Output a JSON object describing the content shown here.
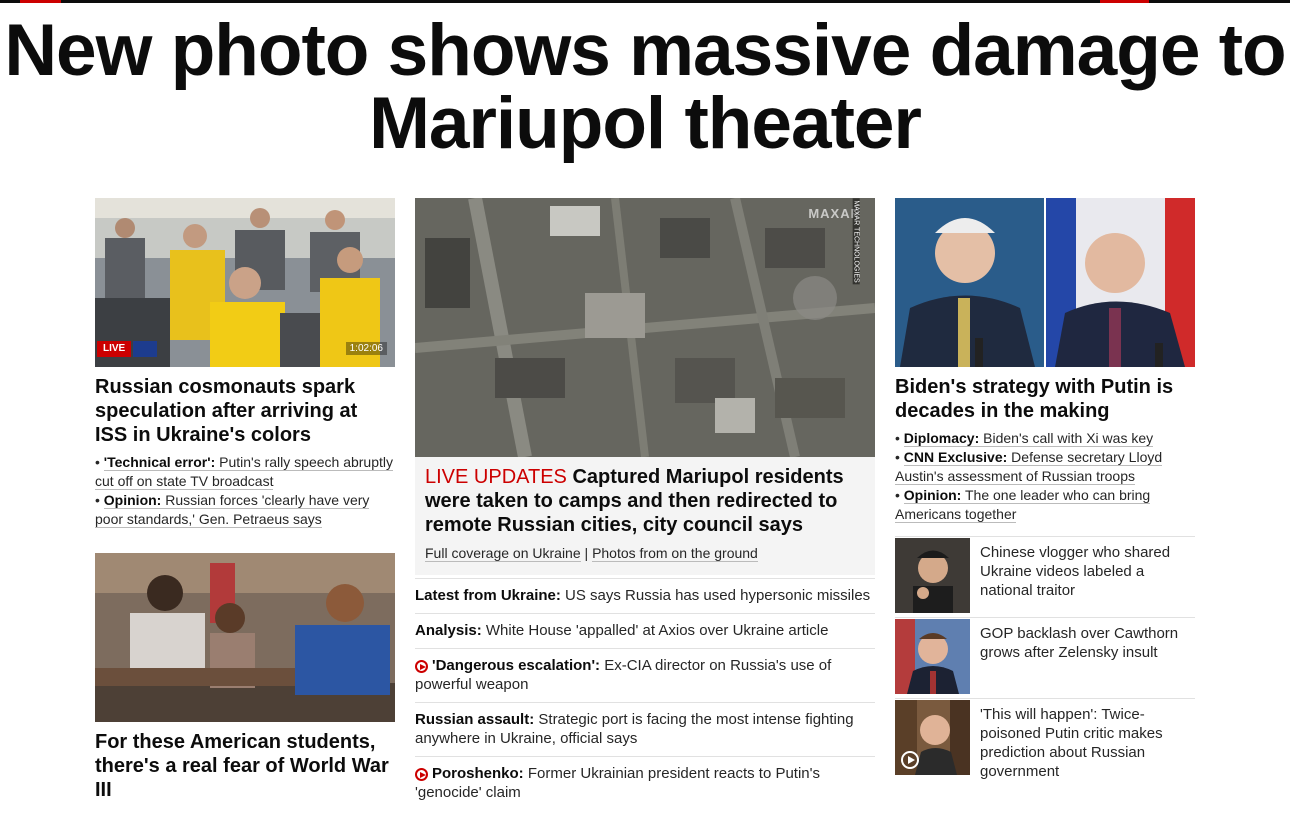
{
  "headline": "New photo shows massive damage to Mariupol theater",
  "left": {
    "story1": {
      "live_label": "LIVE",
      "duration": "1:02:06",
      "title": "Russian cosmonauts spark speculation after arriving at ISS in Ukraine's colors",
      "bullets": [
        {
          "lead": "'Technical error':",
          "text": "Putin's rally speech abruptly cut off on state TV broadcast"
        },
        {
          "lead": "Opinion:",
          "text": "Russian forces 'clearly have very poor standards,' Gen. Petraeus says"
        }
      ]
    },
    "story2": {
      "title": "For these American students, there's a real fear of World War III"
    }
  },
  "middle": {
    "image_credit": "MAXAR TECHNOLOGIES",
    "image_watermark": "MAXAR",
    "live_label": "LIVE UPDATES",
    "title": "Captured Mariupol residents were taken to camps and then redirected to remote Russian cities, city council says",
    "sublinks": [
      "Full coverage on Ukraine",
      "Photos from on the ground"
    ],
    "separator": "|",
    "items": [
      {
        "lead": "Latest from Ukraine:",
        "text": "US says Russia has used hypersonic missiles",
        "video": false
      },
      {
        "lead": "Analysis:",
        "text": "White House 'appalled' at Axios over Ukraine article",
        "video": false
      },
      {
        "lead": "'Dangerous escalation':",
        "text": "Ex-CIA director on Russia's use of powerful weapon",
        "video": true
      },
      {
        "lead": "Russian assault:",
        "text": "Strategic port is facing the most intense fighting anywhere in Ukraine, official says",
        "video": false
      },
      {
        "lead": "Poroshenko:",
        "text": "Former Ukrainian president reacts to Putin's 'genocide' claim",
        "video": true
      }
    ]
  },
  "right": {
    "title": "Biden's strategy with Putin is decades in the making",
    "bullets": [
      {
        "lead": "Diplomacy:",
        "text": "Biden's call with Xi was key"
      },
      {
        "lead": "CNN Exclusive:",
        "text": "Defense secretary Lloyd Austin's assessment of Russian troops"
      },
      {
        "lead": "Opinion:",
        "text": "The one leader who can bring Americans together"
      }
    ],
    "items": [
      {
        "text": "Chinese vlogger who shared Ukraine videos labeled a national traitor"
      },
      {
        "text": "GOP backlash over Cawthorn grows after Zelensky insult"
      },
      {
        "text": "'This will happen': Twice-poisoned Putin critic makes prediction about Russian government"
      }
    ]
  }
}
